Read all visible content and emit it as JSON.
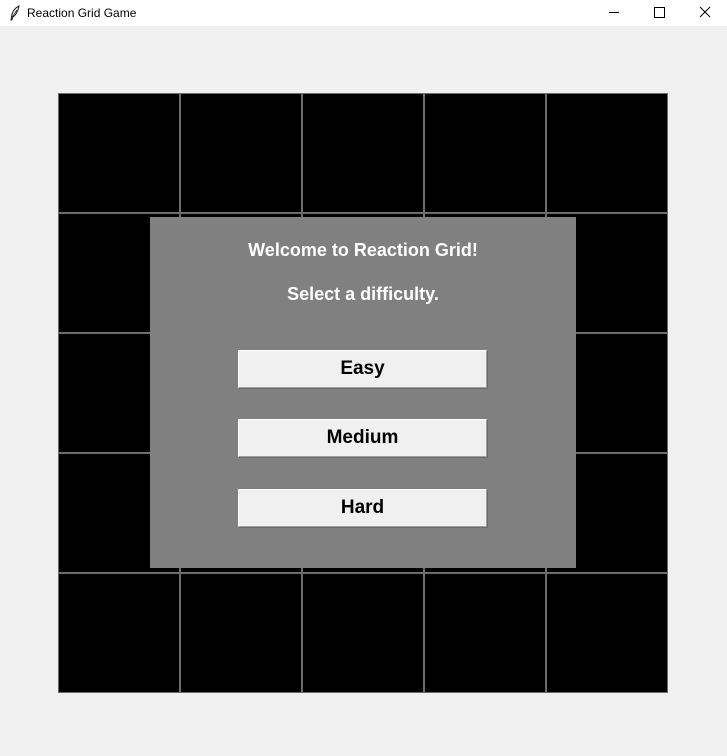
{
  "window": {
    "title": "Reaction Grid Game",
    "icon": "feather-icon",
    "controls": [
      "minimize-icon",
      "maximize-icon",
      "close-icon"
    ]
  },
  "grid": {
    "rows": 5,
    "columns": 5,
    "cell_color": "#000000",
    "grid_line_color": "#6d6d6d"
  },
  "dialog": {
    "background": "#808080",
    "title": "Welcome to Reaction Grid!",
    "subtitle": "Select a difficulty.",
    "buttons": [
      {
        "label": "Easy"
      },
      {
        "label": "Medium"
      },
      {
        "label": "Hard"
      }
    ]
  }
}
